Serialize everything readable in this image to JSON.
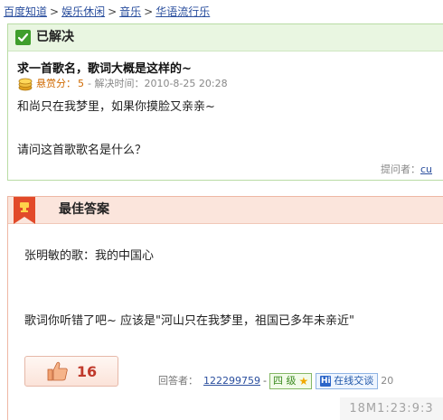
{
  "breadcrumb": [
    {
      "label": "百度知道"
    },
    {
      "label": "娱乐休闲"
    },
    {
      "label": "音乐"
    },
    {
      "label": "华语流行乐"
    }
  ],
  "breadcrumb_separator": ">",
  "question": {
    "status": "已解决",
    "title": "求一首歌名，歌词大概是这样的~",
    "reward_label": "悬赏分：",
    "reward_value": "5",
    "time_label": " - 解决时间：",
    "time_value": "2010-8-25 20:28",
    "body_line1": "和尚只在我梦里，如果你摸脸又亲亲~",
    "body_line2": "请问这首歌歌名是什么？",
    "asker_label": "提问者：",
    "asker_name": "cu"
  },
  "answer": {
    "header": "最佳答案",
    "line1": "张明敏的歌：我的中国心",
    "line2": "歌词你听错了吧~  应该是\"河山只在我梦里，祖国已多年未亲近\"",
    "like_count": "16",
    "answerer_label": "回答者：",
    "answerer_name": "122299759",
    "separator": "-",
    "level": "四 级",
    "chat_label": "在线交谈",
    "chat_icon_text": "Hi",
    "tail_text": "20"
  },
  "watermark": "18M1:23:9:3",
  "colors": {
    "link": "#2b4f9e",
    "resolved_green": "#3f9e2c",
    "answer_accent": "#c0392b",
    "reward_orange": "#d06a00"
  },
  "icons": {
    "status": "check-icon",
    "reward": "coin-icon",
    "answer_flag": "trophy-ribbon-icon",
    "like": "thumbs-up-icon",
    "level": "star-icon",
    "chat": "hi-chat-icon"
  }
}
